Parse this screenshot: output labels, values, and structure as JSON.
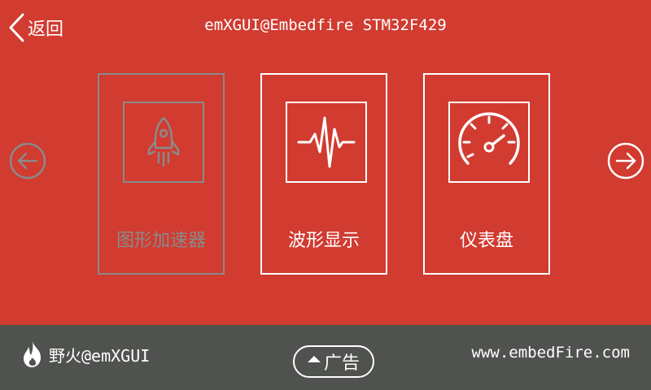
{
  "header": {
    "back_label": "返回",
    "title": "emXGUI@Embedfire STM32F429"
  },
  "cards": [
    {
      "label": "图形加速器",
      "icon": "rocket-icon",
      "enabled": false
    },
    {
      "label": "波形显示",
      "icon": "waveform-icon",
      "enabled": true
    },
    {
      "label": "仪表盘",
      "icon": "gauge-icon",
      "enabled": true
    }
  ],
  "nav": {
    "left_icon": "arrow-left-circle-icon",
    "right_icon": "arrow-right-circle-icon"
  },
  "footer": {
    "brand": "野火@emXGUI",
    "ad_label": "广告",
    "website": "www.embedFire.com"
  },
  "colors": {
    "background": "#d13b30",
    "footer": "#4f524e",
    "disabled": "#8a8a8a",
    "foreground": "#ffffff"
  }
}
